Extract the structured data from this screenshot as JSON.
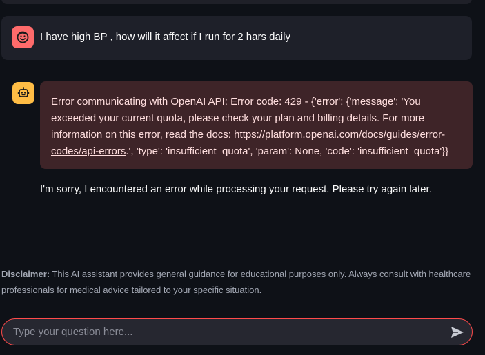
{
  "colors": {
    "background": "#0e1117",
    "user_avatar": "#ff6b6b",
    "bot_avatar": "#ffbd45",
    "error_background": "#3e2428",
    "input_border": "#ff4b4b"
  },
  "icons": {
    "user_avatar": "smiling-face-icon",
    "bot_avatar": "robot-icon",
    "send": "paper-plane-icon"
  },
  "chat": {
    "user_message": "I have high BP , how will it affect if I run for 2 hars daily",
    "error": {
      "text_before_link": "Error communicating with OpenAI API: Error code: 429 - {'error': {'message': 'You exceeded your current quota, please check your plan and billing details. For more information on this error, read the docs: ",
      "link_text": "https://platform.openai.com/docs/guides/error-codes/api-errors",
      "text_after_link": ".', 'type': 'insufficient_quota', 'param': None, 'code': 'insufficient_quota'}}"
    },
    "assistant_message": "I'm sorry, I encountered an error while processing your request. Please try again later."
  },
  "disclaimer": {
    "label": "Disclaimer:",
    "text": " This AI assistant provides general guidance for educational purposes only. Always consult with healthcare professionals for medical advice tailored to your specific situation."
  },
  "input": {
    "placeholder": "Type your question here...",
    "value": ""
  }
}
